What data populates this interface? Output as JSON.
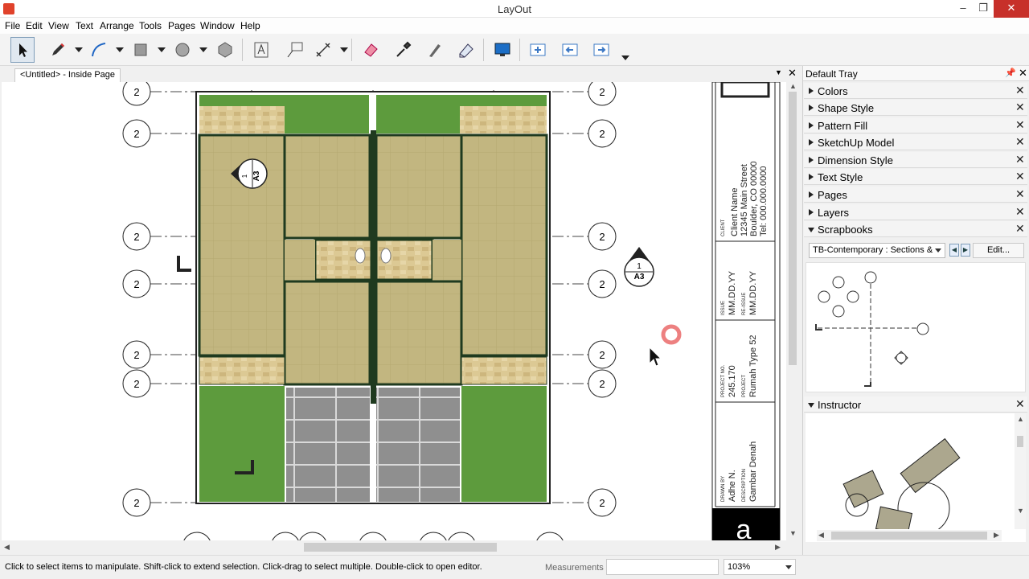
{
  "window": {
    "title": "LayOut",
    "minimize": "–",
    "maximize": "❐",
    "close": "✕"
  },
  "menu": [
    "File",
    "Edit",
    "View",
    "Text",
    "Arrange",
    "Tools",
    "Pages",
    "Window",
    "Help"
  ],
  "toolbar": {
    "tools": [
      "select-tool",
      "pencil-tool",
      "arc-tool",
      "rectangle-tool",
      "circle-tool",
      "polygon-tool",
      "text-tool",
      "label-tool",
      "dimension-tool",
      "eraser-tool",
      "style-picker-tool",
      "split-tool",
      "join-tool",
      "presentation-tool",
      "add-page-tool",
      "previous-page-tool",
      "next-page-tool"
    ]
  },
  "document": {
    "tab_label": "<Untitled> - Inside Page",
    "grid_marker": "2",
    "section_marker": {
      "number": "1",
      "sheet": "A3"
    }
  },
  "title_block": {
    "client_label": "CLIENT",
    "client_lines": [
      "Client Name",
      "12345 Main Street",
      "Boulder, CO 00000",
      "Tel: 000.000.0000"
    ],
    "issue_label": "ISSUE",
    "issue_value": "MM.DD.YY",
    "reissue_label": "RE-ISSUE",
    "reissue_value": "MM.DD.YY",
    "project_no_label": "PROJECT NO.",
    "project_no_value": "245.170",
    "project_label": "PROJECT",
    "project_value": "Rumah Type 52",
    "drawn_by_label": "DRAWN BY",
    "drawn_by_value": "Adhe N.",
    "description_label": "DESCRIPTION",
    "description_value": "Gambar Denah",
    "logo_letter": "a"
  },
  "tray": {
    "title": "Default Tray",
    "panels": [
      "Colors",
      "Shape Style",
      "Pattern Fill",
      "SketchUp Model",
      "Dimension Style",
      "Text Style",
      "Pages",
      "Layers",
      "Scrapbooks"
    ],
    "scrapbook_selected": "TB-Contemporary : Sections &",
    "edit_button": "Edit...",
    "instructor_title": "Instructor"
  },
  "status": {
    "hint": "Click to select items to manipulate. Shift-click to extend selection. Click-drag to select multiple. Double-click to open editor.",
    "measurements_label": "Measurements",
    "measurements_value": "",
    "zoom": "103%"
  },
  "colors": {
    "grass": "#5c9a3c",
    "floor": "#c1b37e",
    "tile": "#d9c48e",
    "paving": "#8e8e8e",
    "wall": "#1f3a1f",
    "accent_click": "#e05050"
  }
}
